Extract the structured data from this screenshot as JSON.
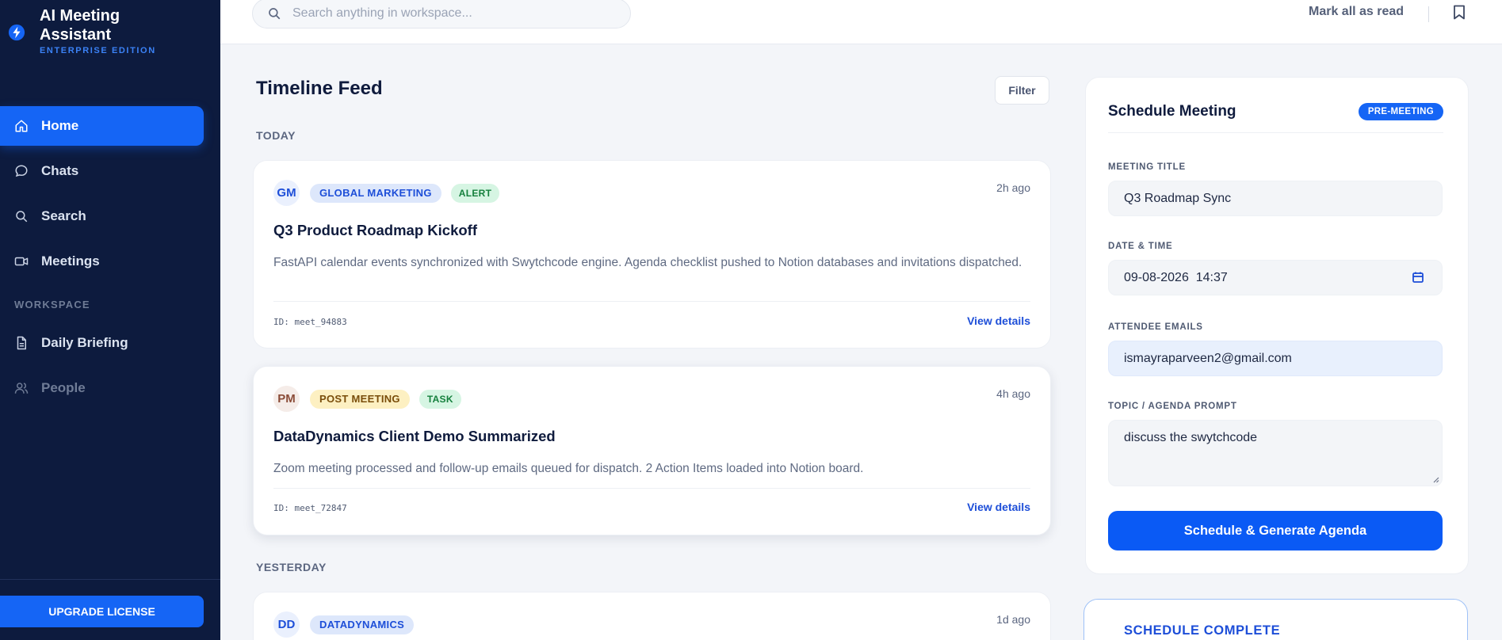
{
  "brand": {
    "title": "AI Meeting Assistant",
    "edition": "ENTERPRISE EDITION"
  },
  "nav": {
    "items": [
      {
        "label": "Home",
        "icon": "home-icon",
        "active": true
      },
      {
        "label": "Chats",
        "icon": "chat-icon"
      },
      {
        "label": "Search",
        "icon": "search-icon"
      },
      {
        "label": "Meetings",
        "icon": "video-icon"
      }
    ],
    "section": "WORKSPACE",
    "workspace_items": [
      {
        "label": "Daily Briefing",
        "icon": "document-icon"
      },
      {
        "label": "People",
        "icon": "people-icon"
      }
    ],
    "upgrade": "UPGRADE LICENSE"
  },
  "topbar": {
    "search_placeholder": "Search anything in workspace...",
    "mark_all_read": "Mark all as read"
  },
  "feed": {
    "title": "Timeline Feed",
    "filter": "Filter",
    "today": "TODAY",
    "yesterday": "YESTERDAY",
    "cards": [
      {
        "initials": "GM",
        "tags": [
          "GLOBAL MARKETING",
          "ALERT"
        ],
        "time": "2h ago",
        "title": "Q3 Product Roadmap Kickoff",
        "body": "FastAPI calendar events synchronized with Swytchcode engine. Agenda checklist pushed to Notion databases and invitations dispatched.",
        "id": "ID: meet_94883",
        "link": "View details"
      },
      {
        "initials": "PM",
        "tags": [
          "POST MEETING",
          "TASK"
        ],
        "time": "4h ago",
        "title": "DataDynamics Client Demo Summarized",
        "body": "Zoom meeting processed and follow-up emails queued for dispatch. 2 Action Items loaded into Notion board.",
        "id": "ID: meet_72847",
        "link": "View details"
      },
      {
        "initials": "DD",
        "tags": [
          "DATADYNAMICS"
        ],
        "time": "1d ago"
      }
    ]
  },
  "schedule": {
    "title": "Schedule Meeting",
    "badge": "PRE-MEETING",
    "meeting_title_label": "MEETING TITLE",
    "meeting_title_value": "Q3 Roadmap Sync",
    "datetime_label": "DATE & TIME",
    "datetime_value": "09-08-2026  14:37",
    "attendees_label": "ATTENDEE EMAILS",
    "attendees_value": "ismayraparveen2@gmail.com",
    "topic_label": "TOPIC / AGENDA PROMPT",
    "topic_value": "discuss the swytchcode",
    "button": "Schedule & Generate Agenda"
  },
  "complete": {
    "title": "SCHEDULE COMPLETE"
  },
  "colors": {
    "sidebar": "#0d1b3e",
    "accent": "#1565f5",
    "link": "#1d4ed8"
  }
}
